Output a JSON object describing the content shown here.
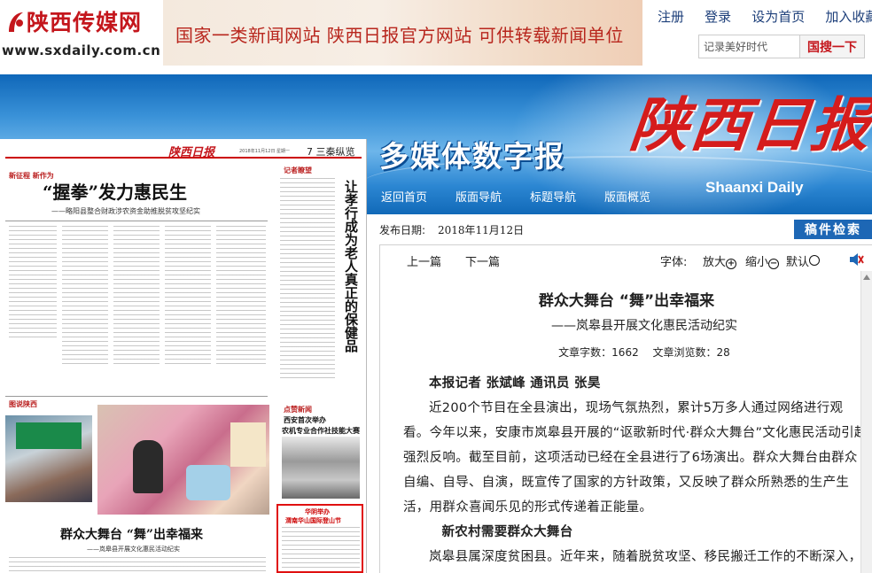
{
  "site": {
    "brand": "陕西传媒网",
    "url": "www.sxdaily.com.cn",
    "slogan": "国家一类新闻网站   陕西日报官方网站   可供转载新闻单位",
    "top_links": [
      "注册",
      "登录",
      "设为首页",
      "加入收藏"
    ],
    "search_placeholder": "记录美好时代",
    "search_button": "国搜一下"
  },
  "masthead": {
    "tagline": "多媒体数字报",
    "paper_title": "陕西日报",
    "paper_en": "Shaanxi Daily"
  },
  "nav": [
    "返回首页",
    "版面导航",
    "标题导航",
    "版面概览"
  ],
  "newspaper": {
    "logo": "陕西日报",
    "page": "7   三秦纵览",
    "date": "2018年11月12日 星期一",
    "section_a": "新征程  新作为",
    "headline": "“握拳”发力惠民生",
    "headline_sub": "——略阳县整合财政涉农资金助推脱贫攻坚纪实",
    "sidebar_title": "让孝行成为老人真正的保健品",
    "section_b": "图说陕西",
    "section_c": "记者瞭望",
    "section_d": "点赞新闻",
    "right_h1": "西安首次举办",
    "right_h2": "农机专业合作社技能大赛",
    "headline2": "群众大舞台 “舞”出幸福来",
    "headline2_sub": "——岚皋县开展文化惠民活动纪实",
    "highlight_t1": "华阴举办",
    "highlight_t2": "渭南华山国际登山节"
  },
  "article": {
    "pub_label": "发布日期:",
    "pub_date": "2018年11月12日",
    "search_button": "稿件检索",
    "prev": "上一篇",
    "next": "下一篇",
    "font_label": "字体:",
    "zoom_in": "放大",
    "zoom_out": "缩小",
    "default": "默认",
    "title": "群众大舞台 “舞”出幸福来",
    "subtitle": "——岚皋县开展文化惠民活动纪实",
    "word_count": "文章字数：1662",
    "view_count": "文章浏览数：28",
    "byline": "本报记者  张斌峰  通讯员  张昊",
    "para1": "近200个节目在全县演出，现场气氛热烈，累计5万多人通过网络进行观看。今年以来，安康市岚皋县开展的“讴歌新时代·群众大舞台”文化惠民活动引起强烈反响。截至目前，这项活动已经在全县进行了6场演出。群众大舞台由群众自编、自导、自演，既宣传了国家的方针政策，又反映了群众所熟悉的生产生活，用群众喜闻乐见的形式传递着正能量。",
    "subhead": "新农村需要群众大舞台",
    "para2": "岚皋县属深度贫困县。近年来，随着脱贫攻坚、移民搬迁工作的不断深入，岚皋县群众的生产生活条件显著改善，对精神文化生活的需求日益增长。"
  },
  "colors": {
    "brand_red": "#c4161c",
    "nav_blue": "#1d67b5",
    "link_blue": "#1d3f7a"
  }
}
